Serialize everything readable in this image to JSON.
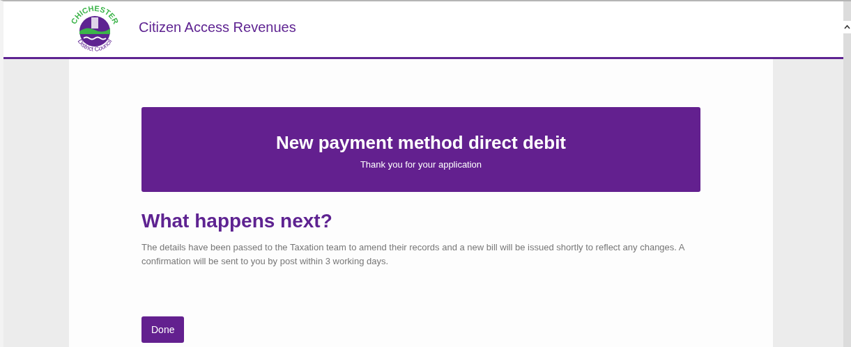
{
  "header": {
    "logo": {
      "top_text": "CHICHESTER",
      "bottom_text": "District Council"
    },
    "title": "Citizen Access Revenues"
  },
  "banner": {
    "title": "New payment method direct debit",
    "subtitle": "Thank you for your application"
  },
  "next_steps": {
    "heading": "What happens next?",
    "body": "The details have been passed to the Taxation team to amend their records and a new bill will be issued shortly to reflect any changes. A confirmation will be sent to you by post within 3 working days."
  },
  "buttons": [
    "Done"
  ]
}
